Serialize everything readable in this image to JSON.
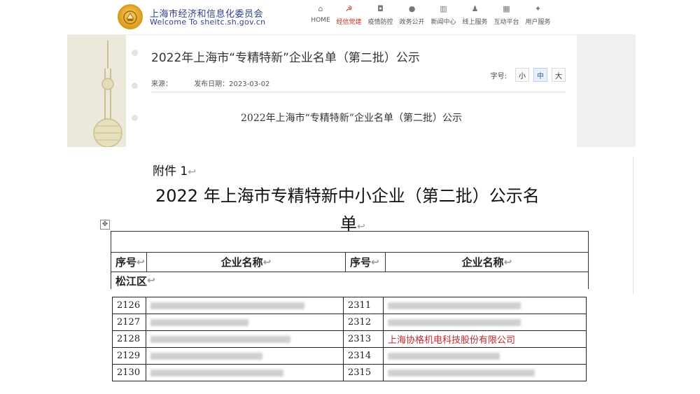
{
  "header": {
    "site_name_cn": "上海市经济和信息化委员会",
    "site_name_en": "Welcome To sheitc.sh.gov.cn",
    "nav": [
      {
        "label": "HOME",
        "icon": "home-icon",
        "glyph": "⌂",
        "active": false
      },
      {
        "label": "经信党建",
        "icon": "party-emblem-icon",
        "glyph": "☭",
        "active": true
      },
      {
        "label": "疫情防控",
        "icon": "shield-icon",
        "glyph": "◘",
        "active": false
      },
      {
        "label": "政务公开",
        "icon": "chat-icon",
        "glyph": "●",
        "active": false
      },
      {
        "label": "新闻中心",
        "icon": "news-icon",
        "glyph": "▥",
        "active": false
      },
      {
        "label": "线上服务",
        "icon": "user-service-icon",
        "glyph": "♟",
        "active": false
      },
      {
        "label": "互动平台",
        "icon": "grid-icon",
        "glyph": "▦",
        "active": false
      },
      {
        "label": "用户服务",
        "icon": "user-icon",
        "glyph": "✦",
        "active": false
      }
    ]
  },
  "article": {
    "title": "2022年上海市“专精特新”企业名单（第二批）公示",
    "source_label": "来源：",
    "date_label": "发布日期：2023-03-02",
    "font_size_label": "字号:",
    "font_sizes": [
      "小",
      "中",
      "大"
    ],
    "content_title": "2022年上海市“专精特新”企业名单（第二批）公示"
  },
  "document": {
    "attachment": "附件 1",
    "title_line1": "2022 年上海市专精特新中小企业（第二批）公示名",
    "title_line2": "单",
    "return_mark": "↩",
    "move_handle": "✥",
    "headers": {
      "index": "序号",
      "name": "企业名称",
      "index2": "序号",
      "name2": "企业名称"
    },
    "district": "松江区",
    "rows": [
      {
        "left_no": "2126",
        "right_no": "2311",
        "right_name": ""
      },
      {
        "left_no": "2127",
        "right_no": "2312",
        "right_name": ""
      },
      {
        "left_no": "2128",
        "right_no": "2313",
        "right_name": "上海协格机电科技股份有限公司"
      },
      {
        "left_no": "2129",
        "right_no": "2314",
        "right_name": ""
      },
      {
        "left_no": "2130",
        "right_no": "2315",
        "right_name": ""
      }
    ]
  },
  "colors": {
    "accent_red": "#c0282d",
    "brand_blue": "#2f3f8f"
  }
}
